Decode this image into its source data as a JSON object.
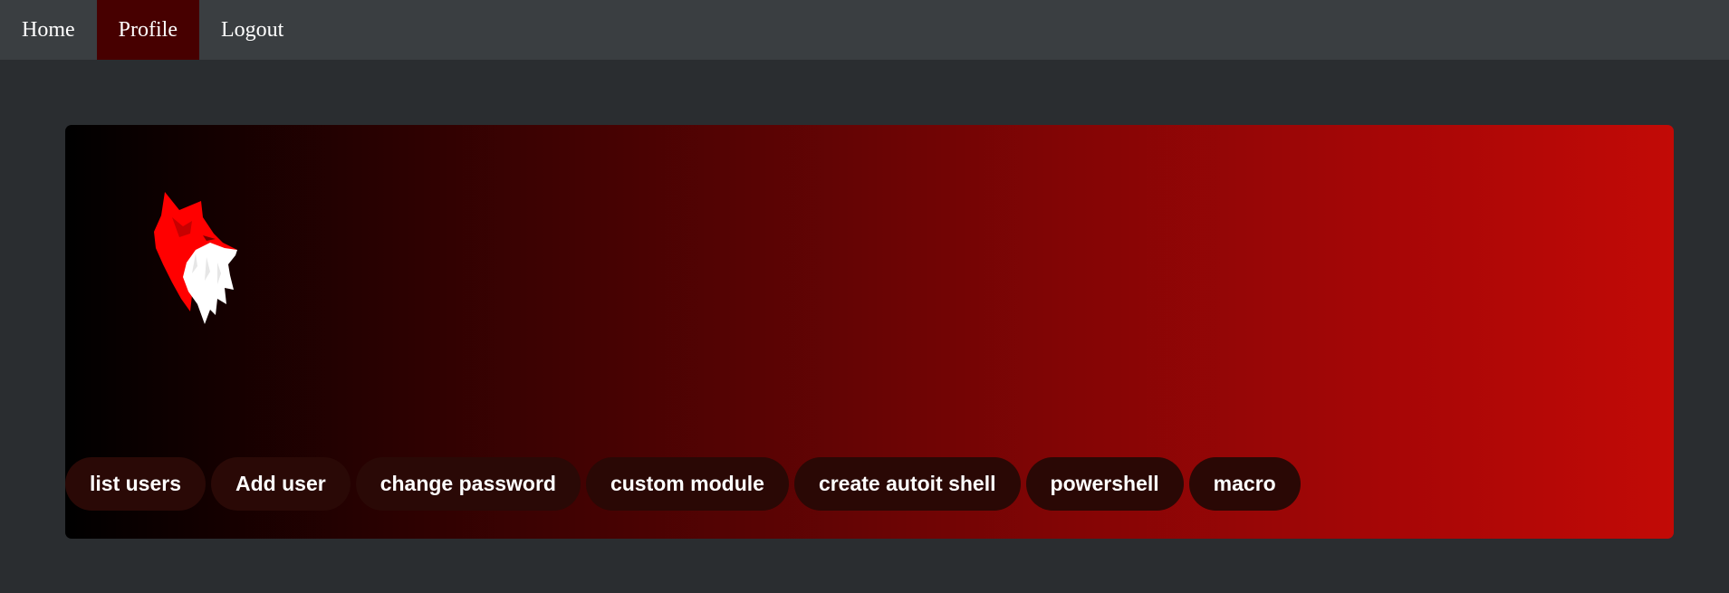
{
  "nav": {
    "items": [
      {
        "label": "Home"
      },
      {
        "label": "Profile"
      },
      {
        "label": "Logout"
      }
    ]
  },
  "banner": {
    "logo_icon": "fox-head-icon",
    "colors": {
      "gradient_start": "#000000",
      "gradient_end": "#c20a06",
      "button_bg": "#2a0805",
      "active_nav_bg": "#470000"
    },
    "actions": [
      {
        "label": "list users"
      },
      {
        "label": "Add user"
      },
      {
        "label": "change password"
      },
      {
        "label": "custom module"
      },
      {
        "label": "create autoit shell"
      },
      {
        "label": "powershell"
      },
      {
        "label": "macro"
      }
    ]
  }
}
